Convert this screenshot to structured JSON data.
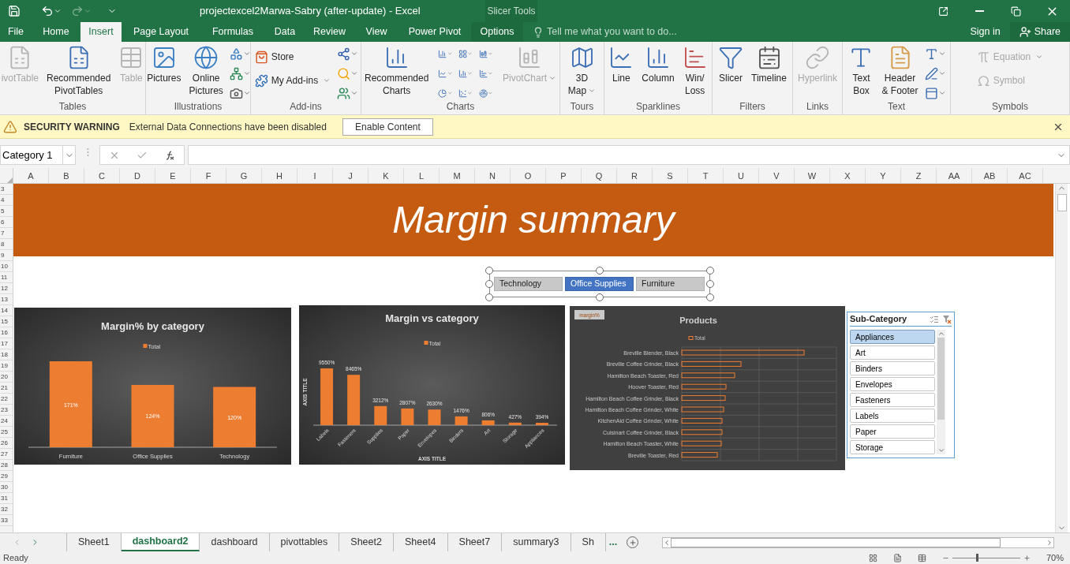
{
  "title_bar": {
    "title": "projectexcel2Marwa-Sabry (after-update) - Excel",
    "context_label": "Slicer Tools"
  },
  "tabs": [
    {
      "label": "File",
      "selected": false,
      "kind": "normal"
    },
    {
      "label": "Home",
      "selected": false,
      "kind": "normal"
    },
    {
      "label": "Insert",
      "selected": true,
      "kind": "normal"
    },
    {
      "label": "Page Layout",
      "selected": false,
      "kind": "normal"
    },
    {
      "label": "Formulas",
      "selected": false,
      "kind": "normal"
    },
    {
      "label": "Data",
      "selected": false,
      "kind": "normal"
    },
    {
      "label": "Review",
      "selected": false,
      "kind": "normal"
    },
    {
      "label": "View",
      "selected": false,
      "kind": "normal"
    },
    {
      "label": "Power Pivot",
      "selected": false,
      "kind": "normal"
    },
    {
      "label": "Options",
      "selected": false,
      "kind": "contextual"
    }
  ],
  "tell_me": {
    "placeholder": "Tell me what you want to do..."
  },
  "sign_in": "Sign in",
  "share": "Share",
  "ribbon": {
    "groups": [
      {
        "label": "Tables",
        "buttons": [
          {
            "lines": [
              "ivotTable"
            ],
            "kind": "large",
            "disabled": true
          },
          {
            "lines": [
              "Recommended",
              "PivotTables"
            ],
            "kind": "large",
            "disabled": false
          },
          {
            "lines": [
              "Table"
            ],
            "kind": "large",
            "disabled": true
          }
        ]
      },
      {
        "label": "Illustrations",
        "buttons": [
          {
            "lines": [
              "Pictures"
            ],
            "kind": "large",
            "disabled": false
          },
          {
            "lines": [
              "Online",
              "Pictures"
            ],
            "kind": "large",
            "disabled": false
          }
        ]
      },
      {
        "label": "Add-ins",
        "buttons": [
          {
            "lines": [
              "Store"
            ],
            "kind": "medium",
            "disabled": false
          },
          {
            "lines": [
              "My Add-ins"
            ],
            "kind": "medium",
            "disabled": false,
            "dropdown": true
          }
        ]
      },
      {
        "label": "Charts",
        "buttons": [
          {
            "lines": [
              "Recommended",
              "Charts"
            ],
            "kind": "large",
            "disabled": false
          },
          {
            "lines": [
              "PivotChart"
            ],
            "kind": "large",
            "disabled": true,
            "dropdown": true
          }
        ]
      },
      {
        "label": "Tours",
        "buttons": [
          {
            "lines": [
              "3D",
              "Map"
            ],
            "kind": "large",
            "disabled": false,
            "dropdown": true
          }
        ]
      },
      {
        "label": "Sparklines",
        "buttons": [
          {
            "lines": [
              "Line"
            ],
            "kind": "large",
            "disabled": false
          },
          {
            "lines": [
              "Column"
            ],
            "kind": "large",
            "disabled": false
          },
          {
            "lines": [
              "Win/",
              "Loss"
            ],
            "kind": "large",
            "disabled": false
          }
        ]
      },
      {
        "label": "Filters",
        "buttons": [
          {
            "lines": [
              "Slicer"
            ],
            "kind": "large",
            "disabled": false
          },
          {
            "lines": [
              "Timeline"
            ],
            "kind": "large",
            "disabled": false
          }
        ]
      },
      {
        "label": "Links",
        "buttons": [
          {
            "lines": [
              "Hyperlink"
            ],
            "kind": "large",
            "disabled": true
          }
        ]
      },
      {
        "label": "Text",
        "buttons": [
          {
            "lines": [
              "Text",
              "Box"
            ],
            "kind": "large",
            "disabled": false
          },
          {
            "lines": [
              "Header",
              "& Footer"
            ],
            "kind": "large",
            "disabled": false
          }
        ]
      },
      {
        "label": "Symbols",
        "buttons": [
          {
            "lines": [
              "Equation"
            ],
            "kind": "medium",
            "disabled": true,
            "dropdown": true
          },
          {
            "lines": [
              "Symbol"
            ],
            "kind": "medium",
            "disabled": true
          }
        ]
      }
    ]
  },
  "security_bar": {
    "title": "SECURITY WARNING",
    "message": "External Data Connections have been disabled",
    "button": "Enable Content"
  },
  "formula_bar": {
    "name_box": "Category 1"
  },
  "sheet": {
    "columns": [
      "A",
      "B",
      "C",
      "D",
      "E",
      "F",
      "G",
      "H",
      "I",
      "J",
      "K",
      "L",
      "M",
      "N",
      "O",
      "P",
      "Q",
      "R",
      "S",
      "T",
      "U",
      "V",
      "W",
      "X",
      "Y",
      "Z",
      "AA",
      "AB",
      "AC"
    ],
    "rows": [
      "3",
      "4",
      "5",
      "6",
      "7",
      "8",
      "9",
      "10",
      "11",
      "12",
      "13",
      "14",
      "15",
      "16",
      "17",
      "18",
      "19",
      "20",
      "21",
      "22",
      "23",
      "24",
      "25",
      "26",
      "27",
      "28",
      "29",
      "30",
      "31",
      "32",
      "33"
    ],
    "banner": "Margin summary",
    "category_slicer": {
      "items": [
        {
          "label": "Technology",
          "selected": false
        },
        {
          "label": "Office Supplies",
          "selected": true
        },
        {
          "label": "Furniture",
          "selected": false
        }
      ]
    },
    "margin_chart": {
      "chart_data": {
        "type": "bar",
        "title": "Margin% by category",
        "categories": [
          "Furniture",
          "Office Supplies",
          "Technology"
        ],
        "series": [
          {
            "name": "Total",
            "color": "#ed7d31",
            "values": [
              171,
              124,
              120
            ],
            "value_labels": [
              "171%",
              "124%",
              "120%"
            ]
          }
        ]
      }
    },
    "category_chart": {
      "chart_data": {
        "type": "bar",
        "title": "Margin vs category",
        "xlabel": "AXIS TITLE",
        "ylabel": "AXIS TITLE",
        "categories": [
          "Labels",
          "Fasteners",
          "Supplies",
          "Paper",
          "Envelopes",
          "Binders",
          "Art",
          "Storage",
          "Appliances"
        ],
        "series": [
          {
            "name": "Total",
            "color": "#ed7d31",
            "values": [
              9550,
              8465,
              3212,
              2807,
              2630,
              1476,
              806,
              427,
              394
            ],
            "value_labels": [
              "9550%",
              "8465%",
              "3212%",
              "2807%",
              "2630%",
              "1476%",
              "806%",
              "427%",
              "394%"
            ]
          }
        ]
      }
    },
    "products_chart": {
      "field_button": "margin%",
      "title": "Products",
      "legend": "Total",
      "products": [
        "Breville Blender, Black",
        "Breville Coffee Grinder, Black",
        "Hamilton Beach Toaster, Red",
        "Hoover Toaster, Red",
        "Hamilton Beach Coffee Grinder, Black",
        "Hamilton Beach Coffee Grinder, White",
        "KitchenAid  Coffee Grinder, White",
        "Cuisinart Coffee Grinder, Black",
        "Hamilton Beach Toaster, White",
        "Breville Toaster, Red"
      ]
    },
    "subcategory_slicer": {
      "title": "Sub-Category",
      "items": [
        {
          "label": "Appliances",
          "selected": true
        },
        {
          "label": "Art",
          "selected": false
        },
        {
          "label": "Binders",
          "selected": false
        },
        {
          "label": "Envelopes",
          "selected": false
        },
        {
          "label": "Fasteners",
          "selected": false
        },
        {
          "label": "Labels",
          "selected": false
        },
        {
          "label": "Paper",
          "selected": false
        },
        {
          "label": "Storage",
          "selected": false
        }
      ]
    }
  },
  "sheet_tabs": [
    {
      "label": "Sheet1",
      "selected": false
    },
    {
      "label": "dashboard2",
      "selected": true
    },
    {
      "label": "dashboard",
      "selected": false
    },
    {
      "label": "pivottables",
      "selected": false
    },
    {
      "label": "Sheet2",
      "selected": false
    },
    {
      "label": "Sheet4",
      "selected": false
    },
    {
      "label": "Sheet7",
      "selected": false
    },
    {
      "label": "summary3",
      "selected": false
    },
    {
      "label": "Sh",
      "selected": false
    }
  ],
  "more_tabs": "...",
  "status_bar": {
    "status": "Ready",
    "zoom": "70%",
    "zoom_level": {
      "level": 0.35
    }
  }
}
